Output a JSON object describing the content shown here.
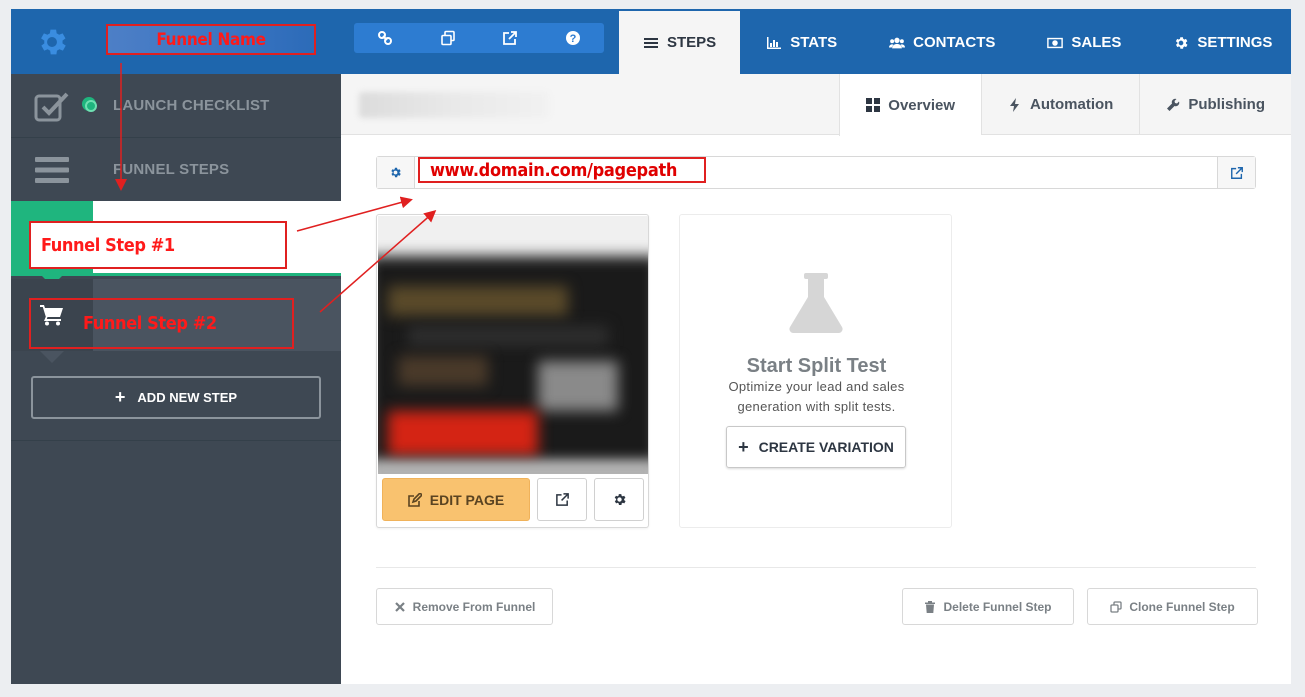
{
  "topbar": {
    "funnel_name_annotation": "Funnel Name",
    "nav": [
      {
        "label": "STEPS",
        "icon": "list-icon",
        "active": true
      },
      {
        "label": "STATS",
        "icon": "bar-chart-icon",
        "active": false
      },
      {
        "label": "CONTACTS",
        "icon": "users-icon",
        "active": false
      },
      {
        "label": "SALES",
        "icon": "money-icon",
        "active": false
      },
      {
        "label": "SETTINGS",
        "icon": "gear-icon",
        "active": false
      }
    ],
    "icon_group": [
      "link-icon",
      "copy-icon",
      "external-link-icon",
      "help-icon"
    ]
  },
  "sidebar": {
    "launch_checklist": "LAUNCH CHECKLIST",
    "funnel_steps": "FUNNEL STEPS",
    "step1_annotation": "Funnel Step #1",
    "step2_annotation": "Funnel Step #2",
    "add_step": "ADD NEW STEP"
  },
  "subtabs": [
    {
      "label": "Overview",
      "icon": "grid-icon",
      "active": true
    },
    {
      "label": "Automation",
      "icon": "bolt-icon",
      "active": false
    },
    {
      "label": "Publishing",
      "icon": "wrench-icon",
      "active": false
    }
  ],
  "url": {
    "annotation": "www.domain.com/pagepath"
  },
  "page_card": {
    "edit_label": "EDIT PAGE"
  },
  "split_test": {
    "title": "Start Split Test",
    "description": "Optimize your lead and sales generation with split tests.",
    "create_label": "CREATE VARIATION"
  },
  "footer": {
    "remove": "Remove From Funnel",
    "delete": "Delete Funnel Step",
    "clone": "Clone Funnel Step"
  },
  "colors": {
    "topbar": "#1e66ad",
    "accent_green": "#1fb57e",
    "sidebar": "#3e4853",
    "edit_button": "#f9c26f",
    "annotation_red": "#e02020"
  }
}
